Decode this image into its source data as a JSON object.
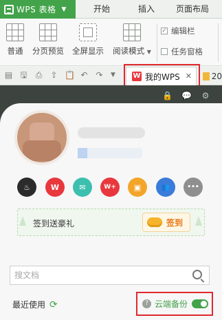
{
  "menubar": {
    "app_name": "WPS 表格",
    "tabs": [
      "开始",
      "插入",
      "页面布局"
    ]
  },
  "ribbon": {
    "buttons": [
      {
        "label": "普通",
        "icon": "normal-view-icon"
      },
      {
        "label": "分页预览",
        "icon": "page-break-preview-icon"
      },
      {
        "label": "全屏显示",
        "icon": "fullscreen-icon"
      },
      {
        "label": "阅读模式",
        "icon": "reading-mode-icon"
      }
    ],
    "checkboxes": [
      {
        "label": "编辑栏",
        "checked": true
      },
      {
        "label": "任务窗格",
        "checked": false
      }
    ]
  },
  "tabs": {
    "active_label": "我的WPS",
    "active_logo": "W",
    "next_label": "20"
  },
  "profile": {
    "apps": [
      {
        "icon": "flame-icon",
        "color": "#2b2b2b",
        "glyph": "♨"
      },
      {
        "icon": "wps-icon",
        "color": "#e8383d",
        "glyph": "W"
      },
      {
        "icon": "mail-icon",
        "color": "#3dbfb0",
        "glyph": "✉"
      },
      {
        "icon": "wps-plus-icon",
        "color": "#e8383d",
        "glyph": "W+"
      },
      {
        "icon": "calendar-icon",
        "color": "#f3a52a",
        "glyph": "▣"
      },
      {
        "icon": "contacts-icon",
        "color": "#3b7bd9",
        "glyph": "👥"
      },
      {
        "icon": "more-icon",
        "color": "#8f8f8f",
        "glyph": "•••"
      }
    ],
    "signin_text": "签到送豪礼",
    "signin_button": "签到"
  },
  "search": {
    "placeholder": "搜文档"
  },
  "footer": {
    "recent_label": "最近使用",
    "backup_label": "云端备份"
  }
}
